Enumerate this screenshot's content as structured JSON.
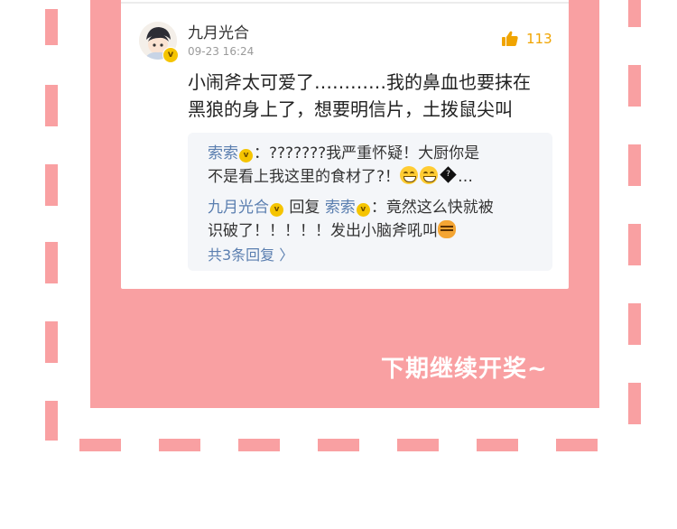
{
  "comment_card": {
    "username": "九月光合",
    "timestamp": "09-23 16:24",
    "like_count": "113",
    "text_line1": "小闹斧太可爱了…………我的鼻血也要抹在",
    "text_line2": "黑狼的身上了，想要明信片，土拨鼠尖叫",
    "verified_badge": "v"
  },
  "replies": {
    "items": [
      {
        "user": "索索",
        "separator": "：",
        "text_line1": "???????我严重怀疑！大厨你是",
        "text_line2_pre": "不是看上我这里的食材了?！",
        "text_line2_post": "…"
      },
      {
        "user": "九月光合",
        "reply_word": " 回复 ",
        "reply_to": "索索",
        "separator": "：",
        "text_line1": "竟然这么快就被",
        "text_line2": "识破了！！！！！发出小脑斧吼叫"
      }
    ],
    "more_label": "共3条回复 〉"
  },
  "footer_label": "下期继续开奖~",
  "icons": [
    "avatar",
    "verified-badge-icon",
    "thumbs-up-icon",
    "grinning-emoji-icon",
    "unknown-glyph-icon",
    "tiger-emoji-icon"
  ],
  "colors": {
    "frame_pink": "#f9a0a2",
    "like_orange": "#f0a400",
    "username_blue": "#5b7fb0",
    "reply_bg": "#f4f6f9"
  }
}
